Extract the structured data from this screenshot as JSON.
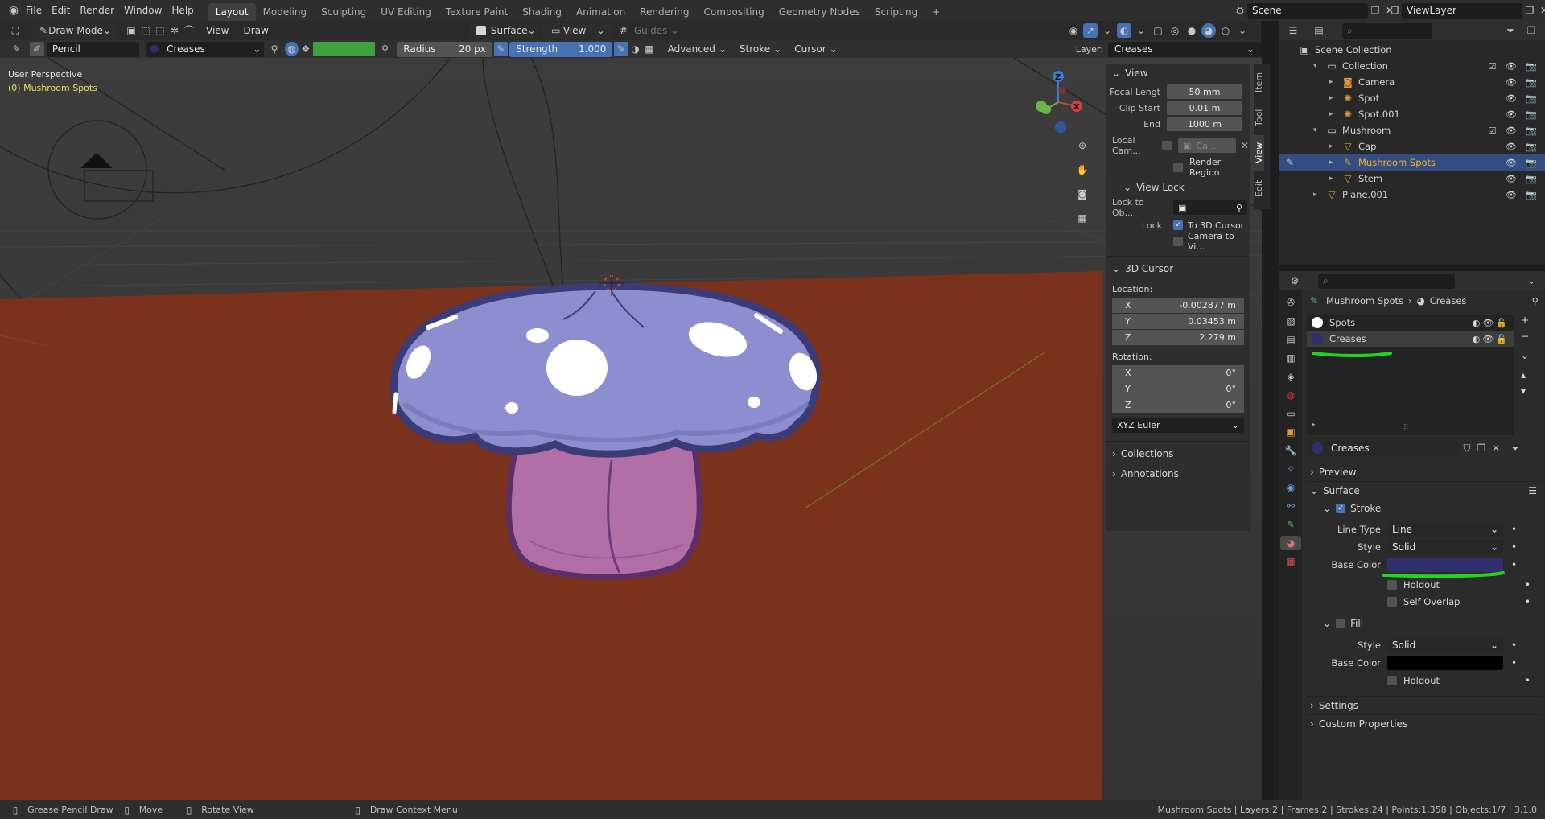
{
  "menu": [
    "File",
    "Edit",
    "Render",
    "Window",
    "Help"
  ],
  "workspaces": [
    "Layout",
    "Modeling",
    "Sculpting",
    "UV Editing",
    "Texture Paint",
    "Shading",
    "Animation",
    "Rendering",
    "Compositing",
    "Geometry Nodes",
    "Scripting"
  ],
  "active_workspace": "Layout",
  "scene": "Scene",
  "view_layer": "ViewLayer",
  "header": {
    "mode": "Draw Mode",
    "view": "View",
    "draw": "Draw",
    "placement": "Surface",
    "orientation": "View",
    "guides": "Guides"
  },
  "tool": {
    "brush": "Pencil",
    "material": "Creases",
    "radius_label": "Radius",
    "radius": "20 px",
    "strength_label": "Strength",
    "strength": "1.000",
    "advanced": "Advanced",
    "stroke": "Stroke",
    "cursor": "Cursor",
    "layer_label": "Layer:",
    "layer": "Creases"
  },
  "viewport": {
    "perspective": "User Perspective",
    "object": "(0) Mushroom Spots"
  },
  "npanel": {
    "tabs": [
      "Item",
      "Tool",
      "View",
      "Edit"
    ],
    "view": {
      "title": "View",
      "focal_label": "Focal Lengt",
      "focal": "50 mm",
      "clip_start_label": "Clip Start",
      "clip_start": "0.01 m",
      "end_label": "End",
      "end": "1000 m",
      "local_cam_label": "Local Cam...",
      "local_cam_value": "Ca...",
      "render_region": "Render Region"
    },
    "view_lock": {
      "title": "View Lock",
      "lock_to_label": "Lock to Ob...",
      "lock_label": "Lock",
      "to_cursor": "To 3D Cursor",
      "camera_to_view": "Camera to Vi..."
    },
    "cursor": {
      "title": "3D Cursor",
      "location_label": "Location:",
      "x": "-0.002877 m",
      "y": "0.03453 m",
      "z": "2.279 m",
      "rotation_label": "Rotation:",
      "rx": "0°",
      "ry": "0°",
      "rz": "0°",
      "mode": "XYZ Euler"
    },
    "collections": "Collections",
    "annotations": "Annotations"
  },
  "outliner": {
    "root": "Scene Collection",
    "rows": [
      {
        "label": "Collection",
        "indent": 1,
        "type": "collection"
      },
      {
        "label": "Camera",
        "indent": 2,
        "type": "camera"
      },
      {
        "label": "Spot",
        "indent": 2,
        "type": "light"
      },
      {
        "label": "Spot.001",
        "indent": 2,
        "type": "light"
      },
      {
        "label": "Mushroom",
        "indent": 1,
        "type": "collection"
      },
      {
        "label": "Cap",
        "indent": 2,
        "type": "mesh"
      },
      {
        "label": "Mushroom Spots",
        "indent": 2,
        "type": "gpencil",
        "selected": true
      },
      {
        "label": "Stem",
        "indent": 2,
        "type": "mesh"
      },
      {
        "label": "Plane.001",
        "indent": 1,
        "type": "mesh"
      }
    ]
  },
  "properties": {
    "breadcrumb_object": "Mushroom Spots",
    "breadcrumb_material": "Creases",
    "slots": [
      "Spots",
      "Creases"
    ],
    "material_name": "Creases",
    "preview": "Preview",
    "surface": "Surface",
    "stroke": "Stroke",
    "line_type_label": "Line Type",
    "line_type": "Line",
    "style_label": "Style",
    "style": "Solid",
    "base_color_label": "Base Color",
    "stroke_color": "#2f2f6e",
    "holdout": "Holdout",
    "self_overlap": "Self Overlap",
    "fill": "Fill",
    "fill_style": "Solid",
    "fill_color": "#000000",
    "settings": "Settings",
    "custom_properties": "Custom Properties"
  },
  "status": {
    "left1": "Grease Pencil Draw",
    "left2": "Move",
    "left3": "Rotate View",
    "left4": "Draw Context Menu",
    "right": "Mushroom Spots | Layers:2 | Frames:2 | Strokes:24 | Points:1,358 | Objects:1/7 | 3.1.0"
  },
  "colors": {
    "accent": "#4772b3",
    "ground": "#7a321c",
    "cap": "#8d8ed0",
    "stem": "#b26ea6",
    "outline": "#3b3b78",
    "highlight_green": "#22d41e"
  }
}
